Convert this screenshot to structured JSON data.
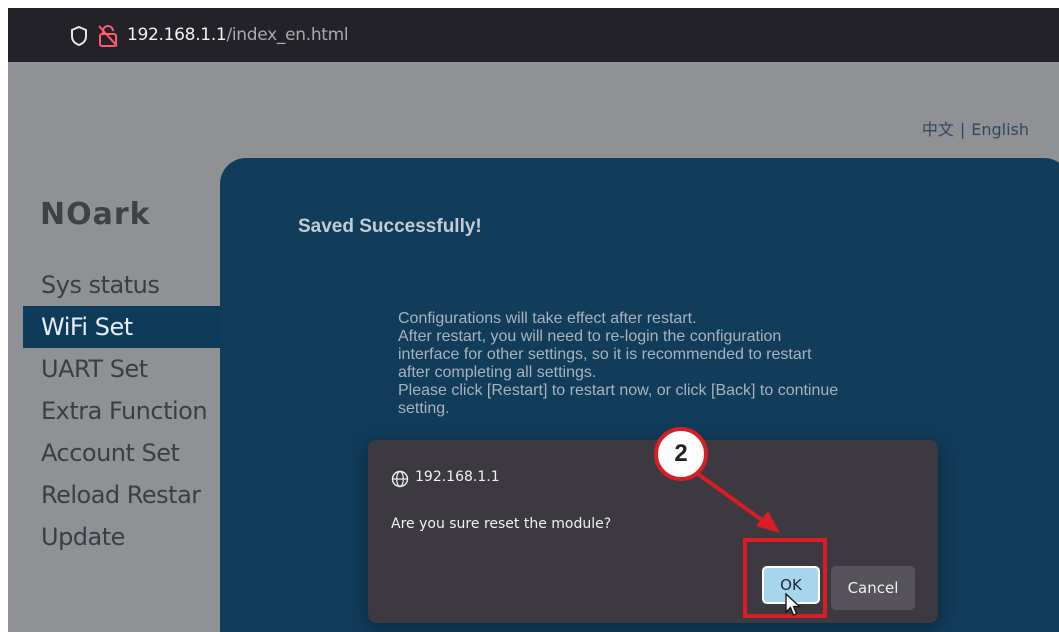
{
  "browser": {
    "url_host": "192.168.1.1",
    "url_path": "/index_en.html",
    "icons": [
      "shield-icon",
      "lock-icon"
    ]
  },
  "language": {
    "chinese": "中文",
    "separator": "|",
    "english": "English"
  },
  "logo": {
    "text": "NOark"
  },
  "sidebar": {
    "items": [
      {
        "label": "Sys status",
        "active": false
      },
      {
        "label": "WiFi Set",
        "active": true
      },
      {
        "label": "UART Set",
        "active": false
      },
      {
        "label": "Extra Function",
        "active": false
      },
      {
        "label": "Account Set",
        "active": false
      },
      {
        "label": "Reload Restar",
        "active": false
      },
      {
        "label": "Update",
        "active": false
      }
    ]
  },
  "panel": {
    "title": "Saved Successfully!",
    "message_lines": [
      "Configurations will take effect after restart.",
      "After restart, you will need to re-login the configuration",
      "interface for other settings, so it is recommended to restart",
      "after completing all settings.",
      "Please click [Restart] to restart now, or click [Back] to continue",
      "setting."
    ]
  },
  "dialog": {
    "host": "192.168.1.1",
    "message": "Are you sure reset the module?",
    "ok_label": "OK",
    "cancel_label": "Cancel"
  },
  "annotation": {
    "step_number": "2",
    "color": "#d81e24"
  },
  "colors": {
    "panel_bg": "#113c5a",
    "active_nav": "#0f3b5b",
    "dialog_bg": "#3c3a40",
    "ok_button": "#a6d5ec"
  }
}
